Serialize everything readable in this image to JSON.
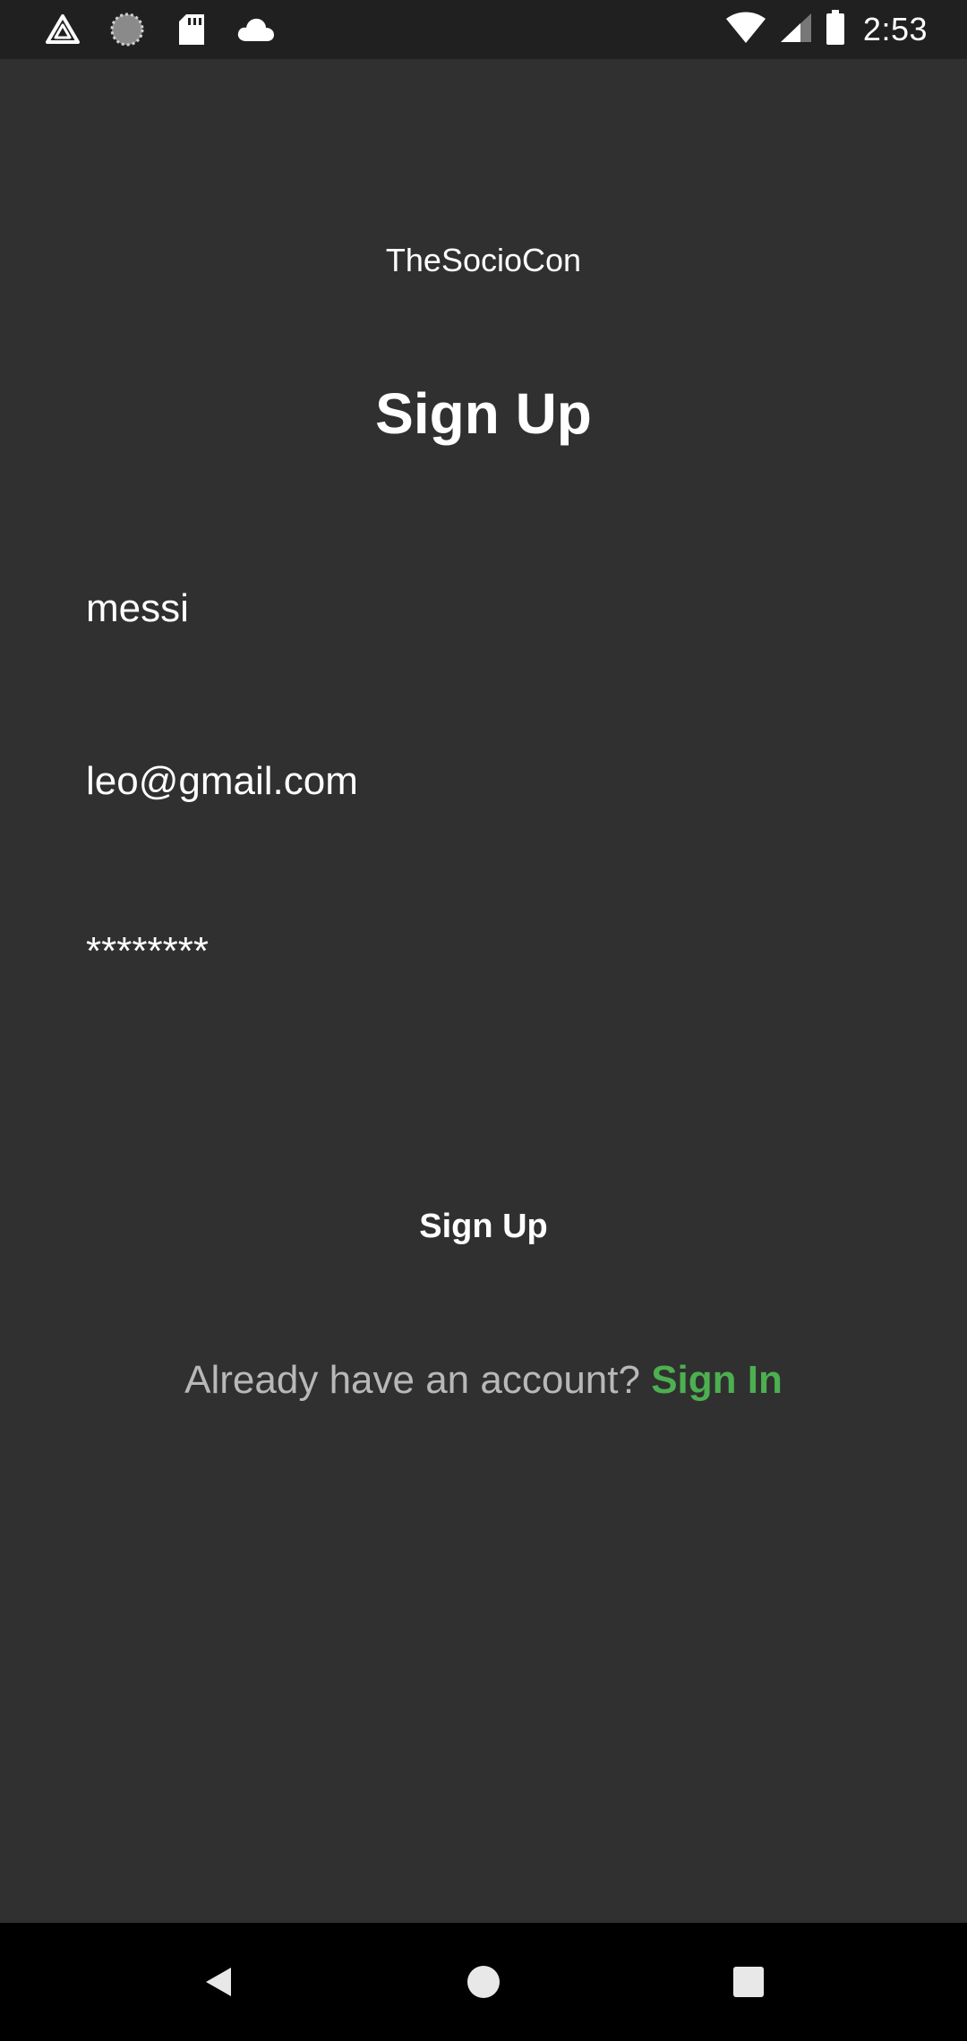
{
  "status_bar": {
    "time": "2:53",
    "left_icons": [
      "triangle-app-icon",
      "sync-spinner-icon",
      "sd-card-icon",
      "cloud-icon"
    ],
    "right_icons": [
      "wifi-icon",
      "cell-signal-icon",
      "battery-icon"
    ]
  },
  "app": {
    "name": "TheSocioCon"
  },
  "page": {
    "title": "Sign Up"
  },
  "form": {
    "username_value": "messi",
    "email_value": "leo@gmail.com",
    "password_value": "********",
    "submit_label": "Sign Up"
  },
  "footer": {
    "prompt": "Already have an account?",
    "link_label": "Sign In",
    "link_color": "#4caf50"
  },
  "nav_bar": {
    "buttons": [
      "back-icon",
      "home-icon",
      "recents-icon"
    ]
  },
  "colors": {
    "background": "#303030",
    "status_bar": "#202020",
    "nav_bar": "#000000",
    "text": "#ffffff",
    "muted_text": "#b8b8b8",
    "accent": "#4caf50"
  }
}
